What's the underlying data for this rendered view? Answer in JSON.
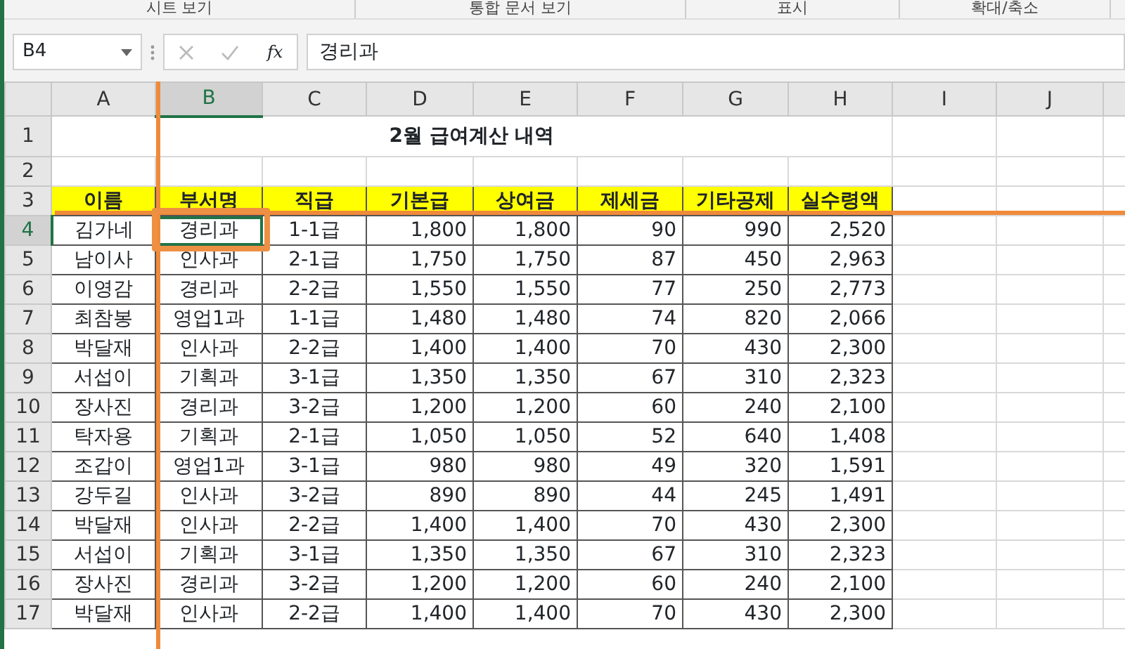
{
  "ribbon_groups": [
    "시트 보기",
    "통합 문서 보기",
    "표시",
    "확대/축소"
  ],
  "formula_bar": {
    "name_box": "B4",
    "function_label": "fx",
    "formula": "경리과"
  },
  "columns": [
    {
      "label": "A",
      "selected": false
    },
    {
      "label": "B",
      "selected": true
    },
    {
      "label": "C",
      "selected": false
    },
    {
      "label": "D",
      "selected": false
    },
    {
      "label": "E",
      "selected": false
    },
    {
      "label": "F",
      "selected": false
    },
    {
      "label": "G",
      "selected": false
    },
    {
      "label": "H",
      "selected": false
    },
    {
      "label": "I",
      "selected": false
    },
    {
      "label": "J",
      "selected": false
    }
  ],
  "sheet": {
    "title": "2월 급여계산 내역",
    "title_row": "1",
    "blank_row": "2",
    "header_row": "3",
    "headers": [
      "이름",
      "부서명",
      "직급",
      "기본급",
      "상여금",
      "제세금",
      "기타공제",
      "실수령액"
    ],
    "rows": [
      {
        "number": "4",
        "selected": true,
        "cells": [
          "김가네",
          "경리과",
          "1-1급",
          "1,800",
          "1,800",
          "90",
          "990",
          "2,520"
        ]
      },
      {
        "number": "5",
        "selected": false,
        "cells": [
          "남이사",
          "인사과",
          "2-1급",
          "1,750",
          "1,750",
          "87",
          "450",
          "2,963"
        ]
      },
      {
        "number": "6",
        "selected": false,
        "cells": [
          "이영감",
          "경리과",
          "2-2급",
          "1,550",
          "1,550",
          "77",
          "250",
          "2,773"
        ]
      },
      {
        "number": "7",
        "selected": false,
        "cells": [
          "최참봉",
          "영업1과",
          "1-1급",
          "1,480",
          "1,480",
          "74",
          "820",
          "2,066"
        ]
      },
      {
        "number": "8",
        "selected": false,
        "cells": [
          "박달재",
          "인사과",
          "2-2급",
          "1,400",
          "1,400",
          "70",
          "430",
          "2,300"
        ]
      },
      {
        "number": "9",
        "selected": false,
        "cells": [
          "서섭이",
          "기획과",
          "3-1급",
          "1,350",
          "1,350",
          "67",
          "310",
          "2,323"
        ]
      },
      {
        "number": "10",
        "selected": false,
        "cells": [
          "장사진",
          "경리과",
          "3-2급",
          "1,200",
          "1,200",
          "60",
          "240",
          "2,100"
        ]
      },
      {
        "number": "11",
        "selected": false,
        "cells": [
          "탁자용",
          "기획과",
          "2-1급",
          "1,050",
          "1,050",
          "52",
          "640",
          "1,408"
        ]
      },
      {
        "number": "12",
        "selected": false,
        "cells": [
          "조갑이",
          "영업1과",
          "3-1급",
          "980",
          "980",
          "49",
          "320",
          "1,591"
        ]
      },
      {
        "number": "13",
        "selected": false,
        "cells": [
          "강두길",
          "인사과",
          "3-2급",
          "890",
          "890",
          "44",
          "245",
          "1,491"
        ]
      },
      {
        "number": "14",
        "selected": false,
        "cells": [
          "박달재",
          "인사과",
          "2-2급",
          "1,400",
          "1,400",
          "70",
          "430",
          "2,300"
        ]
      },
      {
        "number": "15",
        "selected": false,
        "cells": [
          "서섭이",
          "기획과",
          "3-1급",
          "1,350",
          "1,350",
          "67",
          "310",
          "2,323"
        ]
      },
      {
        "number": "16",
        "selected": false,
        "cells": [
          "장사진",
          "경리과",
          "3-2급",
          "1,200",
          "1,200",
          "60",
          "240",
          "2,100"
        ]
      },
      {
        "number": "17",
        "selected": false,
        "cells": [
          "박달재",
          "인사과",
          "2-2급",
          "1,400",
          "1,400",
          "70",
          "430",
          "2,300"
        ]
      }
    ]
  }
}
